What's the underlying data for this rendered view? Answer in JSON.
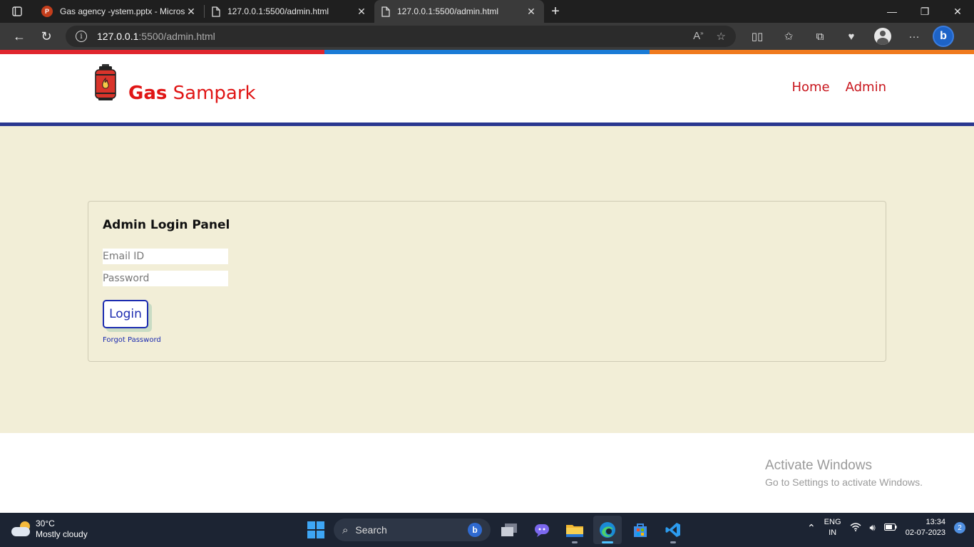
{
  "browser": {
    "tabs": [
      {
        "title": "Gas agency -ystem.pptx - Micros",
        "icon": "powerpoint-icon",
        "active": false
      },
      {
        "title": "127.0.0.1:5500/admin.html",
        "icon": "page-icon",
        "active": false
      },
      {
        "title": "127.0.0.1:5500/admin.html",
        "icon": "page-icon",
        "active": true
      }
    ],
    "url_host": "127.0.0.1",
    "url_path": ":5500/admin.html"
  },
  "accent_strip": [
    "#e0262e",
    "#1a7bd6",
    "#f07a1e"
  ],
  "site": {
    "brand_part1": "Gas",
    "brand_part2": " Sampark",
    "nav": [
      {
        "label": "Home"
      },
      {
        "label": "Admin"
      }
    ],
    "brand_color": "#e01515",
    "rule_color": "#2a3790",
    "bg_color": "#f2eed7"
  },
  "login": {
    "title": "Admin Login Panel",
    "email_placeholder": "Email ID",
    "email_value": "",
    "password_placeholder": "Password",
    "password_value": "",
    "button_label": "Login",
    "forgot_label": "Forgot Password"
  },
  "watermark": {
    "line1": "Activate Windows",
    "line2": "Go to Settings to activate Windows."
  },
  "taskbar": {
    "temperature": "30°C",
    "condition": "Mostly cloudy",
    "search_label": "Search",
    "lang1": "ENG",
    "lang2": "IN",
    "time": "13:34",
    "date": "02-07-2023",
    "notifications": "2"
  }
}
